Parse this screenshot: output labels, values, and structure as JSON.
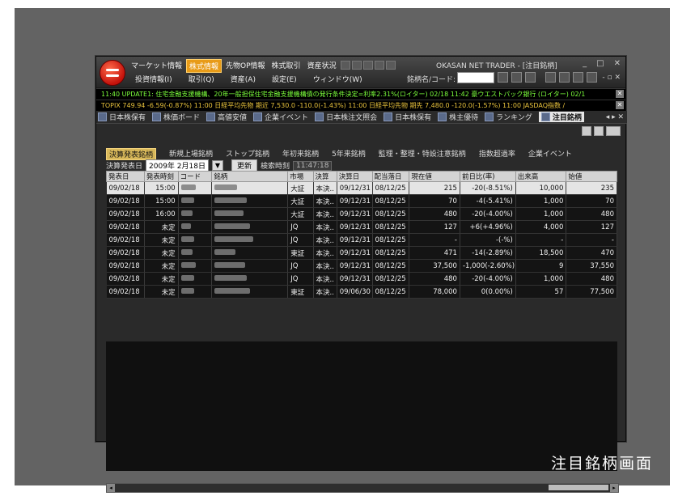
{
  "caption": "注目銘柄画面",
  "app_title": "OKASAN NET TRADER - [注目銘柄]",
  "top_menu": [
    "マーケット情報",
    "株式情報",
    "先物OP情報",
    "株式取引",
    "資産状況"
  ],
  "top_menu_active": "株式情報",
  "menu2": [
    "投資情報(I)",
    "取引(Q)",
    "資産(A)",
    "設定(E)",
    "ウィンドウ(W)"
  ],
  "code_label": "銘柄名/コード:",
  "ticker1": "11:40 UPDATE1: 住宅金融支援機構、20年一般担保住宅金融支援機構債の発行条件決定=利率2.31%(ロイター) 02/18 11:42 豪ウエストパック銀行 (ロイター) 02/1",
  "ticker2": "TOPIX 749.94 -6.59(-0.87%) 11:00    日経平均先物 期近 7,530.0 -110.0(-1.43%) 11:00    日経平均先物 期先 7,480.0 -120.0(-1.57%) 11:00    JASDAQ指数 /",
  "tabs": [
    "日本株保有",
    "株価ボード",
    "高値安値",
    "企業イベント",
    "日本株注文照会",
    "日本株保有",
    "株主優待",
    "ランキング",
    "注目銘柄"
  ],
  "active_tab": "注目銘柄",
  "subtabs": [
    "決算発表銘柄",
    "新規上場銘柄",
    "ストップ銘柄",
    "年初来銘柄",
    "5年来銘柄",
    "監理・整理・特設注意銘柄",
    "指数超過率",
    "企業イベント"
  ],
  "active_subtab": "決算発表銘柄",
  "filter": {
    "label": "決算発表日",
    "date": "2009年 2月18日",
    "update_button": "更新",
    "search_time_label": "検索時刻",
    "search_time": "11:47:18"
  },
  "columns": [
    "発表日",
    "発表時刻",
    "コード",
    "銘柄",
    "市場",
    "決算",
    "決算日",
    "配当落日",
    "現在値",
    "前日比(率)",
    "出来高",
    "始値"
  ],
  "rows": [
    {
      "date": "09/02/18",
      "time": "15:00",
      "market": "大証",
      "kessan": "本決..",
      "kdate": "09/12/31",
      "haito": "08/12/25",
      "price": "215",
      "change": "-20(-8.51%)",
      "chg": "neg",
      "volume": "10,000",
      "open": "235"
    },
    {
      "date": "09/02/18",
      "time": "15:00",
      "market": "大証",
      "kessan": "本決..",
      "kdate": "09/12/31",
      "haito": "08/12/25",
      "price": "70",
      "change": "-4(-5.41%)",
      "chg": "neg",
      "volume": "1,000",
      "open": "70"
    },
    {
      "date": "09/02/18",
      "time": "16:00",
      "market": "大証",
      "kessan": "本決..",
      "kdate": "09/12/31",
      "haito": "08/12/25",
      "price": "480",
      "change": "-20(-4.00%)",
      "chg": "neg",
      "volume": "1,000",
      "open": "480"
    },
    {
      "date": "09/02/18",
      "time": "未定",
      "market": "JQ",
      "kessan": "本決..",
      "kdate": "09/12/31",
      "haito": "08/12/25",
      "price": "127",
      "change": "+6(+4.96%)",
      "chg": "pos",
      "volume": "4,000",
      "open": "127"
    },
    {
      "date": "09/02/18",
      "time": "未定",
      "market": "JQ",
      "kessan": "本決..",
      "kdate": "09/12/31",
      "haito": "08/12/25",
      "price": "-",
      "change": "-(-%)",
      "chg": "",
      "volume": "-",
      "open": "-"
    },
    {
      "date": "09/02/18",
      "time": "未定",
      "market": "東証",
      "kessan": "本決..",
      "kdate": "09/12/31",
      "haito": "08/12/25",
      "price": "471",
      "change": "-14(-2.89%)",
      "chg": "neg",
      "volume": "18,500",
      "open": "470"
    },
    {
      "date": "09/02/18",
      "time": "未定",
      "market": "JQ",
      "kessan": "本決..",
      "kdate": "09/12/31",
      "haito": "08/12/25",
      "price": "37,500",
      "change": "-1,000(-2.60%)",
      "chg": "neg",
      "volume": "9",
      "open": "37,550"
    },
    {
      "date": "09/02/18",
      "time": "未定",
      "market": "JQ",
      "kessan": "本決..",
      "kdate": "09/12/31",
      "haito": "08/12/25",
      "price": "480",
      "change": "-20(-4.00%)",
      "chg": "neg",
      "volume": "1,000",
      "open": "480"
    },
    {
      "date": "09/02/18",
      "time": "未定",
      "market": "東証",
      "kessan": "本決..",
      "kdate": "09/06/30",
      "haito": "08/12/25",
      "price": "78,000",
      "change": "0(0.00%)",
      "chg": "",
      "volume": "57",
      "open": "77,500"
    }
  ]
}
